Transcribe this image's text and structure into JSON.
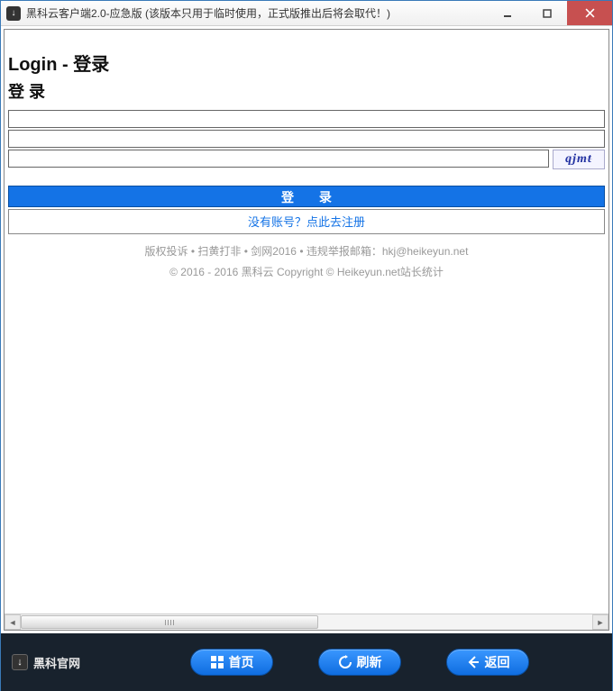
{
  "window": {
    "title": "黑科云客户端2.0-应急版 (该版本只用于临时使用，正式版推出后将会取代！)"
  },
  "login": {
    "heading": "Login - 登录",
    "subheading": "登 录",
    "username_value": "",
    "password_value": "",
    "captcha_value": "",
    "captcha_text": "qjmt",
    "submit_label": "登 录",
    "register_text": "没有账号？点此去注册"
  },
  "footer": {
    "line1": "版权投诉 • 扫黄打非 • 剑网2016 • 违规举报邮箱：hkj@heikeyun.net",
    "line2": "© 2016 - 2016 黑科云 Copyright © Heikeyun.net站长统计"
  },
  "toolbar": {
    "brand": "黑科官网",
    "home_label": "首页",
    "refresh_label": "刷新",
    "back_label": "返回"
  }
}
